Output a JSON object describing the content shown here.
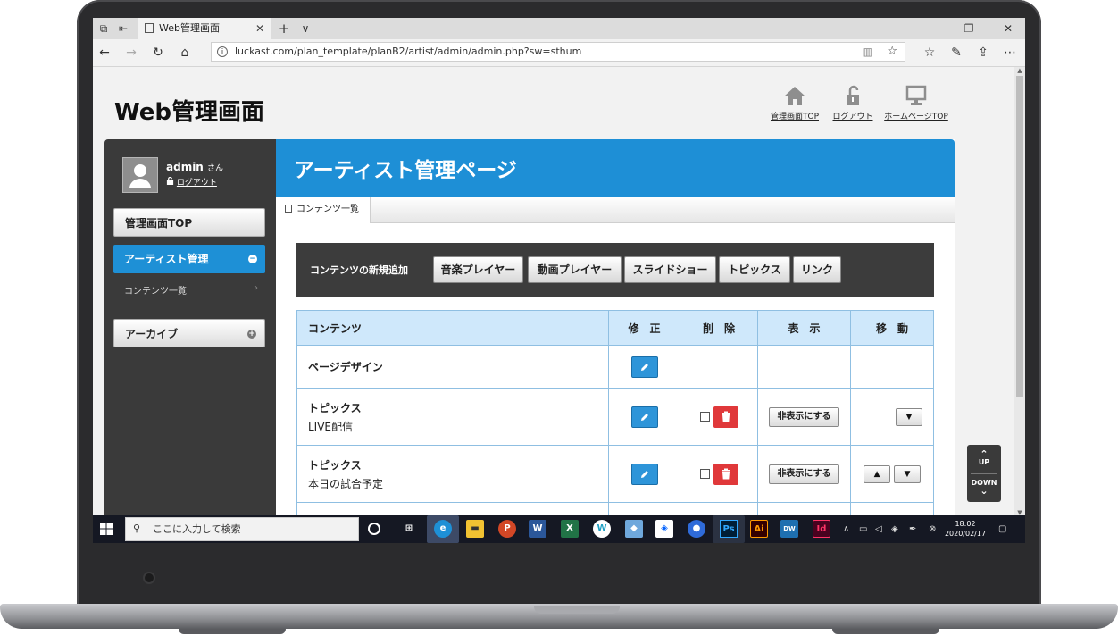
{
  "browser": {
    "tab_title": "Web管理画面",
    "tab_close": "✕",
    "new_tab": "+",
    "tab_list": "∨",
    "url": "luckast.com/plan_template/planB2/artist/admin/admin.php?sw=sthum",
    "info_glyph": "i"
  },
  "header": {
    "site_title": "Web管理画面",
    "nav": [
      {
        "label": "管理画面TOP",
        "icon": "home-icon"
      },
      {
        "label": "ログアウト",
        "icon": "lock-open-icon"
      },
      {
        "label": "ホームページTOP",
        "icon": "monitor-icon"
      }
    ]
  },
  "sidebar": {
    "user_name": "admin",
    "user_suffix": "さん",
    "logout": "ログアウト",
    "items": [
      {
        "label": "管理画面TOP"
      },
      {
        "label": "アーティスト管理",
        "badge": "−"
      },
      {
        "label": "コンテンツ一覧",
        "chev": "›"
      },
      {
        "label": "アーカイブ",
        "badge": "+"
      }
    ]
  },
  "main": {
    "title": "アーティスト管理ページ",
    "subtab": "コンテンツ一覧",
    "new_label": "コンテンツの新規追加",
    "new_buttons": [
      "音楽プレイヤー",
      "動画プレイヤー",
      "スライドショー",
      "トピックス",
      "リンク"
    ],
    "columns": [
      "コンテンツ",
      "修　正",
      "削　除",
      "表　示",
      "移　動"
    ],
    "rows": [
      {
        "name": "ページデザイン",
        "sub": ""
      },
      {
        "name": "トピックス",
        "sub": "LIVE配信",
        "hide": "非表示にする",
        "down": "▼"
      },
      {
        "name": "トピックス",
        "sub": "本日の試合予定",
        "hide": "非表示にする",
        "up": "▲",
        "down": "▼"
      }
    ]
  },
  "updown": {
    "up_arrow": "⌃",
    "up": "UP",
    "down": "DOWN",
    "down_arrow": "⌄"
  },
  "taskbar": {
    "search_placeholder": "ここに入力して検索",
    "time": "18:02",
    "date": "2020/02/17"
  },
  "colors": {
    "accent": "#1e8fd6",
    "danger": "#e0383a",
    "table_head": "#cfe8fb"
  }
}
